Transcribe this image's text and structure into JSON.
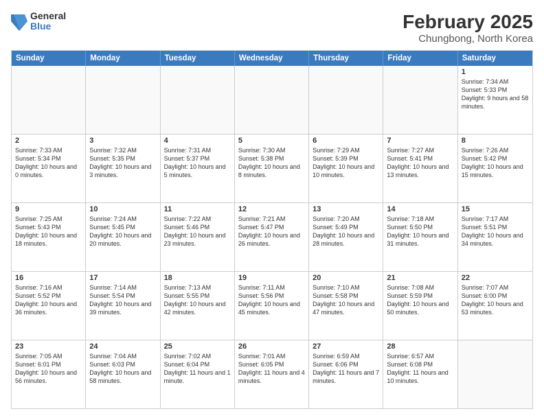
{
  "logo": {
    "general": "General",
    "blue": "Blue"
  },
  "header": {
    "title": "February 2025",
    "location": "Chungbong, North Korea"
  },
  "weekdays": [
    "Sunday",
    "Monday",
    "Tuesday",
    "Wednesday",
    "Thursday",
    "Friday",
    "Saturday"
  ],
  "rows": [
    [
      {
        "day": "",
        "info": ""
      },
      {
        "day": "",
        "info": ""
      },
      {
        "day": "",
        "info": ""
      },
      {
        "day": "",
        "info": ""
      },
      {
        "day": "",
        "info": ""
      },
      {
        "day": "",
        "info": ""
      },
      {
        "day": "1",
        "info": "Sunrise: 7:34 AM\nSunset: 5:33 PM\nDaylight: 9 hours and 58 minutes."
      }
    ],
    [
      {
        "day": "2",
        "info": "Sunrise: 7:33 AM\nSunset: 5:34 PM\nDaylight: 10 hours and 0 minutes."
      },
      {
        "day": "3",
        "info": "Sunrise: 7:32 AM\nSunset: 5:35 PM\nDaylight: 10 hours and 3 minutes."
      },
      {
        "day": "4",
        "info": "Sunrise: 7:31 AM\nSunset: 5:37 PM\nDaylight: 10 hours and 5 minutes."
      },
      {
        "day": "5",
        "info": "Sunrise: 7:30 AM\nSunset: 5:38 PM\nDaylight: 10 hours and 8 minutes."
      },
      {
        "day": "6",
        "info": "Sunrise: 7:29 AM\nSunset: 5:39 PM\nDaylight: 10 hours and 10 minutes."
      },
      {
        "day": "7",
        "info": "Sunrise: 7:27 AM\nSunset: 5:41 PM\nDaylight: 10 hours and 13 minutes."
      },
      {
        "day": "8",
        "info": "Sunrise: 7:26 AM\nSunset: 5:42 PM\nDaylight: 10 hours and 15 minutes."
      }
    ],
    [
      {
        "day": "9",
        "info": "Sunrise: 7:25 AM\nSunset: 5:43 PM\nDaylight: 10 hours and 18 minutes."
      },
      {
        "day": "10",
        "info": "Sunrise: 7:24 AM\nSunset: 5:45 PM\nDaylight: 10 hours and 20 minutes."
      },
      {
        "day": "11",
        "info": "Sunrise: 7:22 AM\nSunset: 5:46 PM\nDaylight: 10 hours and 23 minutes."
      },
      {
        "day": "12",
        "info": "Sunrise: 7:21 AM\nSunset: 5:47 PM\nDaylight: 10 hours and 26 minutes."
      },
      {
        "day": "13",
        "info": "Sunrise: 7:20 AM\nSunset: 5:49 PM\nDaylight: 10 hours and 28 minutes."
      },
      {
        "day": "14",
        "info": "Sunrise: 7:18 AM\nSunset: 5:50 PM\nDaylight: 10 hours and 31 minutes."
      },
      {
        "day": "15",
        "info": "Sunrise: 7:17 AM\nSunset: 5:51 PM\nDaylight: 10 hours and 34 minutes."
      }
    ],
    [
      {
        "day": "16",
        "info": "Sunrise: 7:16 AM\nSunset: 5:52 PM\nDaylight: 10 hours and 36 minutes."
      },
      {
        "day": "17",
        "info": "Sunrise: 7:14 AM\nSunset: 5:54 PM\nDaylight: 10 hours and 39 minutes."
      },
      {
        "day": "18",
        "info": "Sunrise: 7:13 AM\nSunset: 5:55 PM\nDaylight: 10 hours and 42 minutes."
      },
      {
        "day": "19",
        "info": "Sunrise: 7:11 AM\nSunset: 5:56 PM\nDaylight: 10 hours and 45 minutes."
      },
      {
        "day": "20",
        "info": "Sunrise: 7:10 AM\nSunset: 5:58 PM\nDaylight: 10 hours and 47 minutes."
      },
      {
        "day": "21",
        "info": "Sunrise: 7:08 AM\nSunset: 5:59 PM\nDaylight: 10 hours and 50 minutes."
      },
      {
        "day": "22",
        "info": "Sunrise: 7:07 AM\nSunset: 6:00 PM\nDaylight: 10 hours and 53 minutes."
      }
    ],
    [
      {
        "day": "23",
        "info": "Sunrise: 7:05 AM\nSunset: 6:01 PM\nDaylight: 10 hours and 56 minutes."
      },
      {
        "day": "24",
        "info": "Sunrise: 7:04 AM\nSunset: 6:03 PM\nDaylight: 10 hours and 58 minutes."
      },
      {
        "day": "25",
        "info": "Sunrise: 7:02 AM\nSunset: 6:04 PM\nDaylight: 11 hours and 1 minute."
      },
      {
        "day": "26",
        "info": "Sunrise: 7:01 AM\nSunset: 6:05 PM\nDaylight: 11 hours and 4 minutes."
      },
      {
        "day": "27",
        "info": "Sunrise: 6:59 AM\nSunset: 6:06 PM\nDaylight: 11 hours and 7 minutes."
      },
      {
        "day": "28",
        "info": "Sunrise: 6:57 AM\nSunset: 6:08 PM\nDaylight: 11 hours and 10 minutes."
      },
      {
        "day": "",
        "info": ""
      }
    ]
  ]
}
